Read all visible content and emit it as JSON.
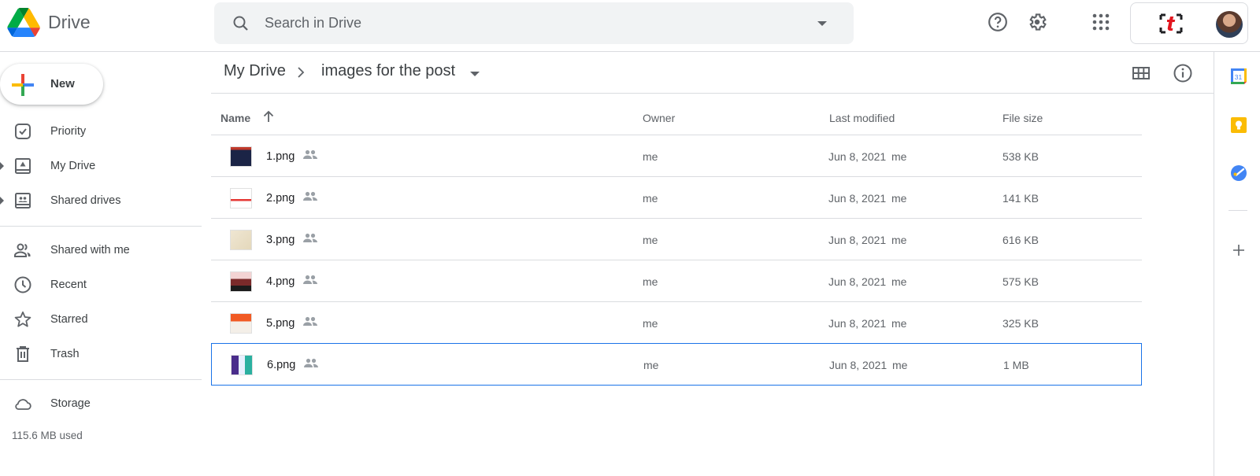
{
  "app": {
    "name": "Drive"
  },
  "search": {
    "placeholder": "Search in Drive",
    "value": ""
  },
  "topbar": {
    "icons": [
      "help-icon",
      "settings-icon",
      "apps-icon"
    ],
    "account_brand": "[t]"
  },
  "sidebar": {
    "new_label": "New",
    "items": [
      {
        "label": "Priority",
        "icon": "priority-icon",
        "expandable": false
      },
      {
        "label": "My Drive",
        "icon": "my-drive-icon",
        "expandable": true
      },
      {
        "label": "Shared drives",
        "icon": "shared-drives-icon",
        "expandable": true
      },
      {
        "label": "Shared with me",
        "icon": "shared-with-me-icon",
        "expandable": false
      },
      {
        "label": "Recent",
        "icon": "recent-icon",
        "expandable": false
      },
      {
        "label": "Starred",
        "icon": "star-icon",
        "expandable": false
      },
      {
        "label": "Trash",
        "icon": "trash-icon",
        "expandable": false
      },
      {
        "label": "Storage",
        "icon": "cloud-icon",
        "expandable": false
      }
    ],
    "storage_used": "115.6 MB used"
  },
  "breadcrumb": {
    "root": "My Drive",
    "current": "images for the post"
  },
  "table": {
    "headers": {
      "name": "Name",
      "owner": "Owner",
      "modified": "Last modified",
      "size": "File size"
    },
    "sort": "ascending",
    "rows": [
      {
        "name": "1.png",
        "owner": "me",
        "modified": "Jun 8, 2021",
        "modified_by": "me",
        "size": "538 KB",
        "selected": false
      },
      {
        "name": "2.png",
        "owner": "me",
        "modified": "Jun 8, 2021",
        "modified_by": "me",
        "size": "141 KB",
        "selected": false
      },
      {
        "name": "3.png",
        "owner": "me",
        "modified": "Jun 8, 2021",
        "modified_by": "me",
        "size": "616 KB",
        "selected": false
      },
      {
        "name": "4.png",
        "owner": "me",
        "modified": "Jun 8, 2021",
        "modified_by": "me",
        "size": "575 KB",
        "selected": false
      },
      {
        "name": "5.png",
        "owner": "me",
        "modified": "Jun 8, 2021",
        "modified_by": "me",
        "size": "325 KB",
        "selected": false
      },
      {
        "name": "6.png",
        "owner": "me",
        "modified": "Jun 8, 2021",
        "modified_by": "me",
        "size": "1 MB",
        "selected": true
      }
    ]
  },
  "rightbar": {
    "calendar_day": "31",
    "apps": [
      "calendar-icon",
      "keep-icon",
      "tasks-icon",
      "add-addon-icon"
    ]
  },
  "colors": {
    "accent": "#1a73e8",
    "text": "#3c4043",
    "muted": "#5f6368",
    "divider": "#dadce0"
  }
}
